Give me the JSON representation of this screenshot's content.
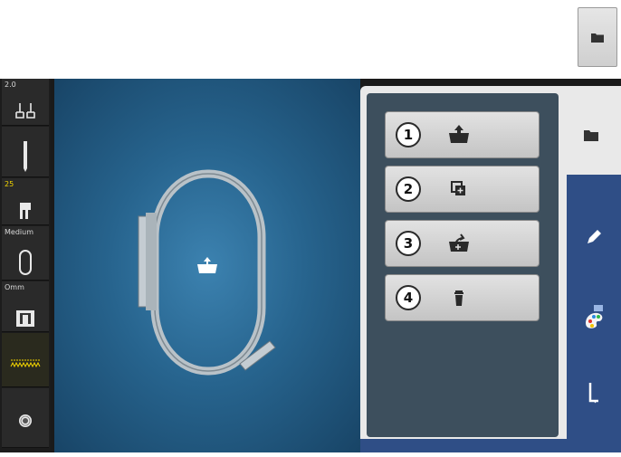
{
  "left_bar": {
    "stitch_width": "2.0",
    "stitch_length": "25",
    "hoop_label": "Medium",
    "speed_label": "Omm"
  },
  "panel": {
    "buttons": [
      {
        "number": "1",
        "icon": "folder-upload-icon"
      },
      {
        "number": "2",
        "icon": "duplicate-icon"
      },
      {
        "number": "3",
        "icon": "open-folder-icon"
      },
      {
        "number": "4",
        "icon": "trash-icon"
      }
    ]
  },
  "tabs": [
    "folder-icon",
    "pencil-icon",
    "color-palette-icon",
    "needle-icon"
  ],
  "colors": {
    "accent_blue": "#2f4e86",
    "canvas_blue": "#27648e",
    "panel_dark": "#3d4f5d"
  }
}
